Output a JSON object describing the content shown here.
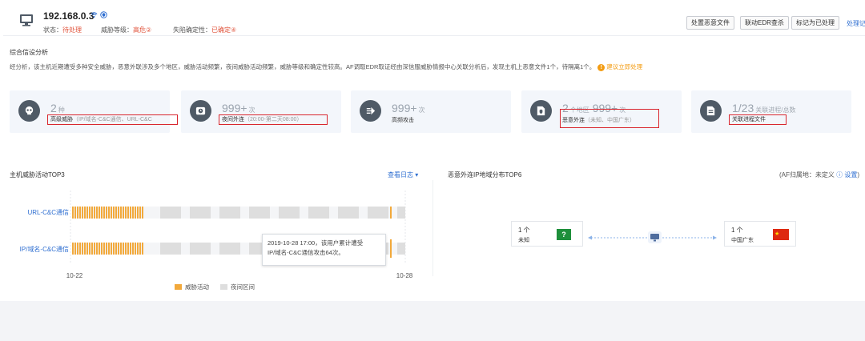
{
  "header": {
    "host_ip": "192.168.0.3",
    "status_label": "状态：",
    "status_value": "待处理",
    "threat_label": "威胁等级：",
    "threat_value": "高危②",
    "confirm_label": "失陷确定性：",
    "confirm_value": "已确定④",
    "buttons": [
      "处置恶意文件",
      "联动EDR查杀",
      "标记为已处理"
    ],
    "link": "处理记录"
  },
  "analysis": {
    "title": "综合信设分析",
    "summary": "经分析，该主机近期遭受多种安全威胁，恶意外联涉及多个地区，威胁活动频繁，夜间威胁活动频繁，威胁等级和确定性较高。AF调取EDR取证经由深信服威胁情报中心关联分析后，发现主机上恶意文件1个，待隔离1个。",
    "summary_link": "建议立即处理"
  },
  "cards": [
    {
      "icon": "skull-icon",
      "num": "2",
      "unit": "种",
      "label": "高级威胁",
      "sub": "（IP/域名-C&C通信、URL-C&C"
    },
    {
      "icon": "clock-icon",
      "num": "999+",
      "unit": "次",
      "label": "夜间外连",
      "sub": "（20:00-第二天08:00）"
    },
    {
      "icon": "arrow-right-icon",
      "num": "999+",
      "unit": "次",
      "label": "高频攻击",
      "sub": ""
    },
    {
      "icon": "file-shield-icon",
      "num": "2",
      "unit": "个地区",
      "num2": "999+",
      "unit2": "次",
      "label": "恶意外连",
      "sub": "（未知、中国广东）"
    },
    {
      "icon": "file-icon",
      "num": "1/23",
      "unit": "关联进程/总数",
      "label": "关联进程文件",
      "sub": ""
    }
  ],
  "timeline": {
    "title": "主机威胁活动TOP3",
    "view_log": "查看日志",
    "rows": [
      "URL-C&C通信",
      "IP/域名-C&C通信"
    ],
    "x_start": "10-22",
    "x_end": "10-28",
    "tooltip_line1": "2019-10-28 17:00，该用户累计遭受",
    "tooltip_line2": "IP/域名-C&C通信攻击64次。",
    "legend_threat": "威胁活动",
    "legend_night": "夜间区间",
    "colors": {
      "threat": "#f2a93b",
      "night": "#dedede"
    }
  },
  "geo": {
    "title": "恶意外连IP地域分布TOP6",
    "note_prefix": "(AF归属地：未定义",
    "note_link": "设置",
    "note_suffix": ")",
    "boxes": [
      {
        "count": "1 个",
        "location": "未知"
      },
      {
        "count": "1 个",
        "location": "中国广东"
      }
    ]
  }
}
